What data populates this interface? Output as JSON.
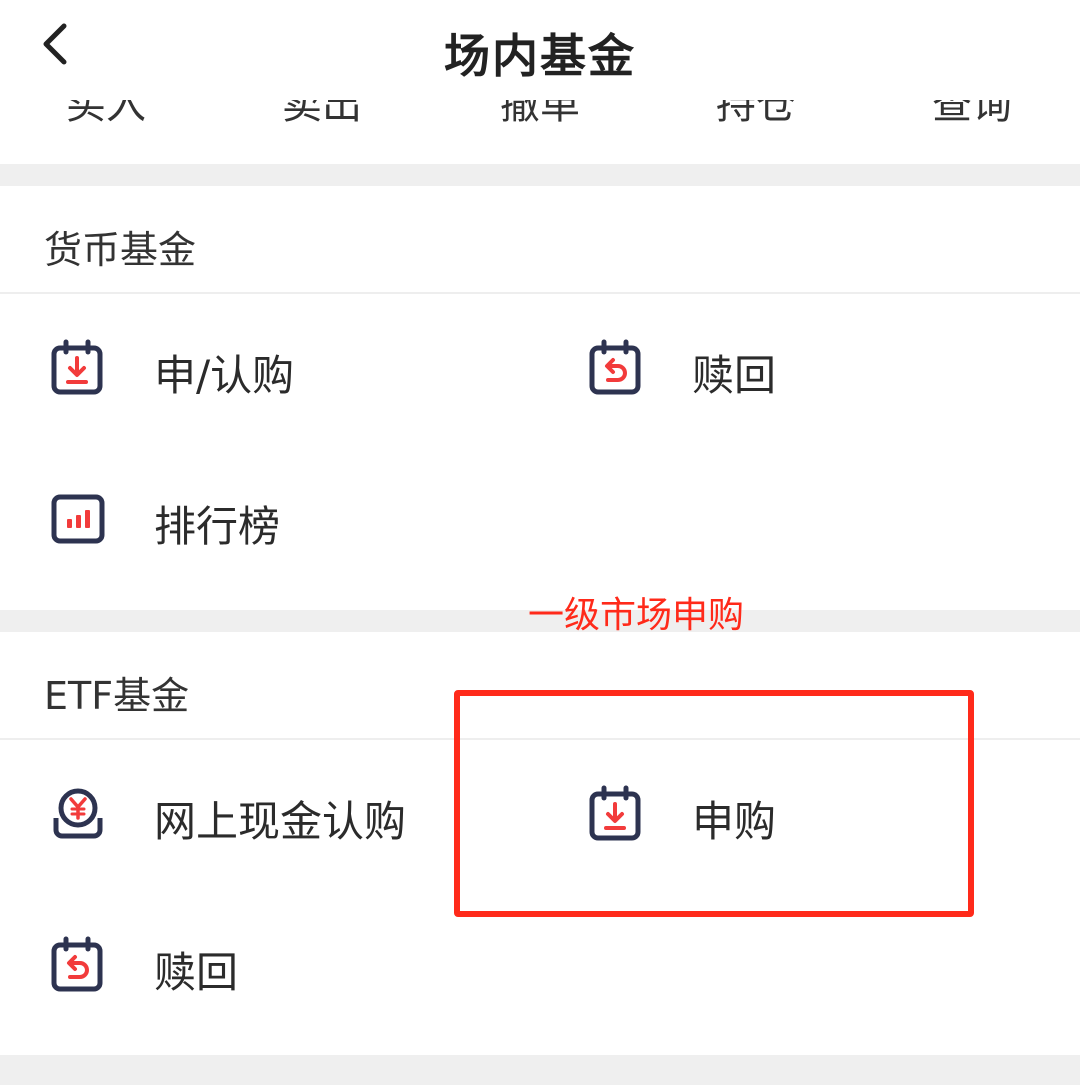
{
  "header": {
    "title": "场内基金",
    "back_icon": "chevron-left-icon"
  },
  "quick_actions": [
    "买入",
    "卖出",
    "撤单",
    "持仓",
    "查询"
  ],
  "sections": [
    {
      "title": "货币基金",
      "items": [
        {
          "label": "申/认购",
          "icon": "calendar-download-icon"
        },
        {
          "label": "赎回",
          "icon": "calendar-return-icon"
        },
        {
          "label": "排行榜",
          "icon": "bar-chart-icon"
        }
      ]
    },
    {
      "title": "ETF基金",
      "items": [
        {
          "label": "网上现金认购",
          "icon": "yuan-coin-icon"
        },
        {
          "label": "申购",
          "icon": "calendar-download-icon"
        },
        {
          "label": "赎回",
          "icon": "calendar-return-icon"
        }
      ]
    }
  ],
  "annotation": {
    "text": "一级市场申购",
    "color": "#ff2a1a"
  },
  "colors": {
    "icon_outline": "#2d3350",
    "icon_accent": "#f23b3b",
    "section_gap": "#efefef"
  }
}
